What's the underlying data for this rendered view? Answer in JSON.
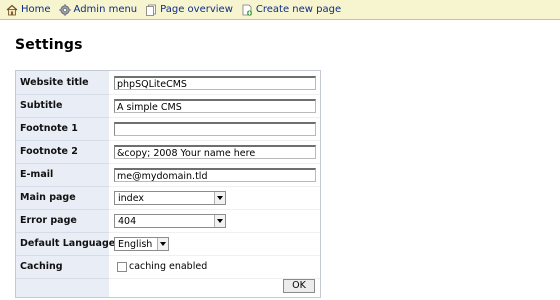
{
  "nav": {
    "home": "Home",
    "admin_menu": "Admin menu",
    "page_overview": "Page overview",
    "create_new_page": "Create new page"
  },
  "page_title": "Settings",
  "fields": {
    "website_title": {
      "label": "Website title",
      "value": "phpSQLiteCMS"
    },
    "subtitle": {
      "label": "Subtitle",
      "value": "A simple CMS"
    },
    "footnote1": {
      "label": "Footnote 1",
      "value": ""
    },
    "footnote2": {
      "label": "Footnote 2",
      "value": "&copy; 2008 Your name here"
    },
    "email": {
      "label": "E-mail",
      "value": "me@mydomain.tld"
    },
    "main_page": {
      "label": "Main page",
      "value": "index"
    },
    "error_page": {
      "label": "Error page",
      "value": "404"
    },
    "default_language": {
      "label": "Default Language",
      "value": "English"
    },
    "caching": {
      "label": "Caching",
      "checkbox_label": "caching enabled",
      "checked": false
    }
  },
  "submit_label": "OK",
  "colors": {
    "topbar_bg": "#f7f4d0",
    "link": "#0d2d8a",
    "label_column_bg": "#e9eef6"
  },
  "icons": {
    "home": "house-icon",
    "admin_menu": "gear-icon",
    "page_overview": "pages-icon",
    "create_new_page": "new-page-icon"
  }
}
